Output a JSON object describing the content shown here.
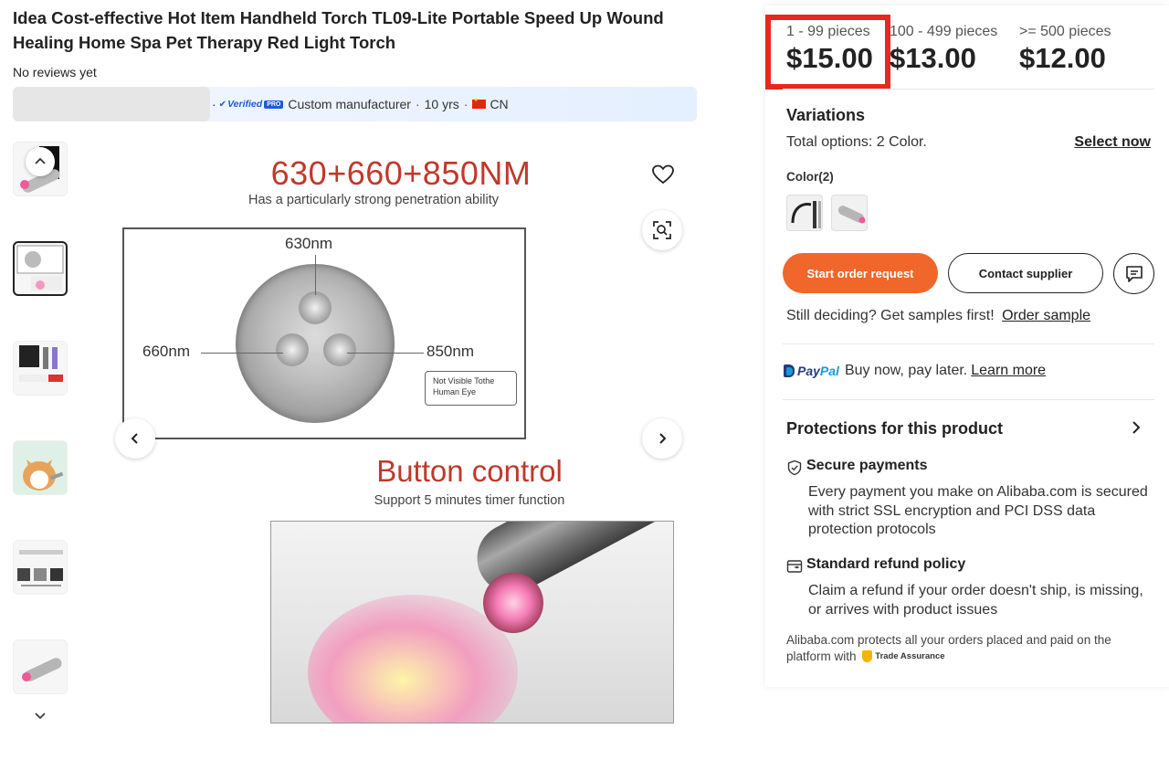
{
  "product": {
    "title": "Idea Cost-effective Hot Item Handheld Torch TL09-Lite Portable Speed Up Wound Healing Home Spa Pet Therapy Red Light Torch",
    "reviews": "No reviews yet"
  },
  "supplier": {
    "verified_text": "Verified",
    "pro_text": "PRO",
    "type": "Custom manufacturer",
    "years": "10 yrs",
    "country": "CN",
    "separator": "·"
  },
  "main_image": {
    "spec_title": "630+660+850NM",
    "spec_subtitle": "Has a particularly strong penetration ability",
    "wavelength_top": "630nm",
    "wavelength_left": "660nm",
    "wavelength_right": "850nm",
    "not_visible_note": "Not Visible Tothe Human Eye",
    "button_title": "Button control",
    "timer_text": "Support 5 minutes timer function"
  },
  "thumbnails": [
    {
      "name": "thumb-torch-pink"
    },
    {
      "name": "thumb-spec-sheet"
    },
    {
      "name": "thumb-product-set"
    },
    {
      "name": "thumb-corgi-dog"
    },
    {
      "name": "thumb-accessories"
    },
    {
      "name": "thumb-torch-silver"
    }
  ],
  "pricing": {
    "tiers": [
      {
        "qty": "1 - 99 pieces",
        "price": "$15.00"
      },
      {
        "qty": "100 - 499 pieces",
        "price": "$13.00"
      },
      {
        "qty": ">= 500 pieces",
        "price": "$12.00"
      }
    ],
    "highlight_color": "#e8281e"
  },
  "variations": {
    "heading": "Variations",
    "total_options": "Total options: 2 Color.",
    "select_now": "Select now",
    "color_label": "Color(2)"
  },
  "actions": {
    "start_order": "Start order request",
    "contact_supplier": "Contact supplier",
    "start_order_color": "#f1662a"
  },
  "samples": {
    "text": "Still deciding? Get samples first!",
    "link": "Order sample"
  },
  "paypal": {
    "logo_part1": "Pay",
    "logo_part2": "Pal",
    "text": "Buy now, pay later.",
    "link": "Learn more"
  },
  "protections": {
    "heading": "Protections for this product",
    "secure_title": "Secure payments",
    "secure_text": "Every payment you make on Alibaba.com is secured with strict SSL encryption and PCI DSS data protection protocols",
    "refund_title": "Standard refund policy",
    "refund_text": "Claim a refund if your order doesn't ship, is missing, or arrives with product issues",
    "assurance_text": "Alibaba.com protects all your orders placed and paid on the platform with",
    "assurance_badge": "Trade Assurance"
  }
}
